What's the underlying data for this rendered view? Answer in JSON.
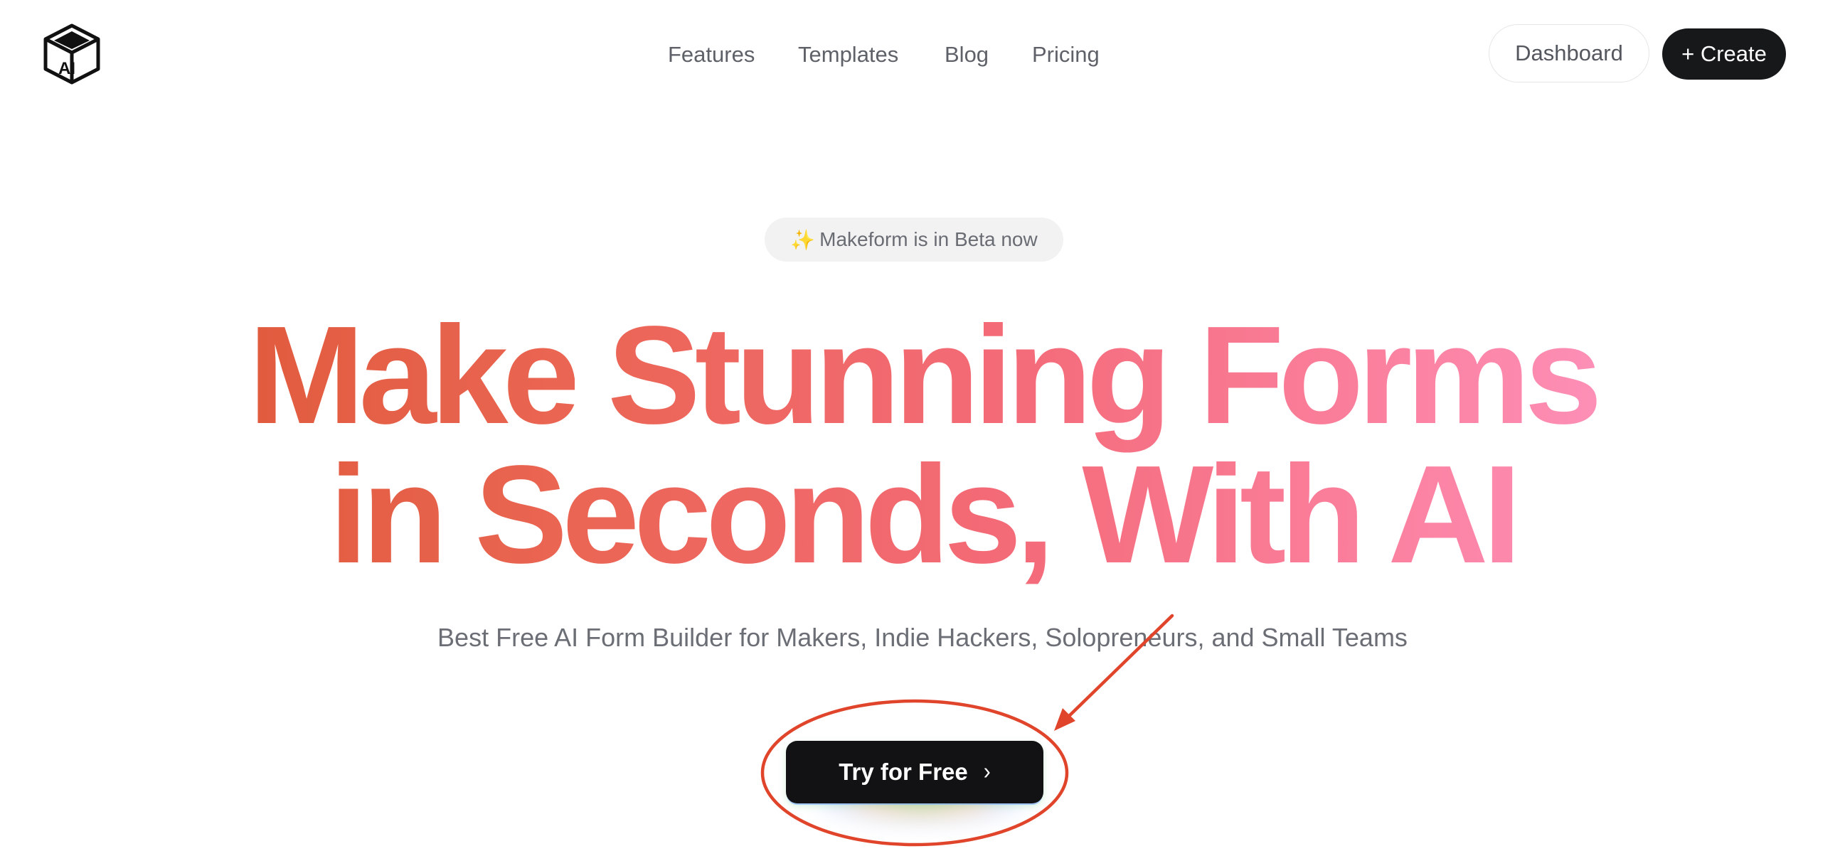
{
  "brand": {
    "logo_icon": "cube-logo-icon",
    "logo_letters": "AI"
  },
  "nav": {
    "links": [
      "Features",
      "Templates",
      "Blog",
      "Pricing"
    ],
    "dashboard_label": "Dashboard",
    "create_label": "+ Create"
  },
  "hero": {
    "badge_icon": "sparkles-icon",
    "badge_sparkle": "✨",
    "badge_text": "Makeform is in Beta now",
    "headline_line1": [
      "Make",
      "Stunning",
      "Forms"
    ],
    "headline_line2": [
      "in",
      "Seconds,",
      "With",
      "AI"
    ],
    "subtitle": "Best Free AI Form Builder for Makers, Indie Hackers, Solopreneurs, and Small Teams",
    "cta_label": "Try for Free",
    "cta_chevron": "›"
  },
  "colors": {
    "gradient_start": "#d9542e",
    "gradient_mid": "#f46b79",
    "gradient_end": "#ff9fd0",
    "annotation_red": "#e0452b",
    "cta_bg": "#121214"
  },
  "annotation": {
    "type": "red ellipse with arrow highlighting the CTA button"
  }
}
